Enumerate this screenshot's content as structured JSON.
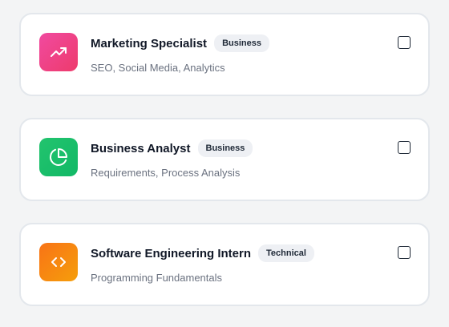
{
  "cards": [
    {
      "title": "Marketing Specialist",
      "badge": "Business",
      "skills": "SEO, Social Media, Analytics",
      "icon": "trending-up-icon",
      "gradient": [
        "#f04aa0",
        "#ee3b6c"
      ],
      "checked": false
    },
    {
      "title": "Business Analyst",
      "badge": "Business",
      "skills": "Requirements, Process Analysis",
      "icon": "pie-chart-icon",
      "gradient": [
        "#22c46e",
        "#12b866"
      ],
      "checked": false
    },
    {
      "title": "Software Engineering Intern",
      "badge": "Technical",
      "skills": "Programming Fundamentals",
      "icon": "code-icon",
      "gradient": [
        "#f97316",
        "#f59e0b"
      ],
      "checked": false
    }
  ]
}
